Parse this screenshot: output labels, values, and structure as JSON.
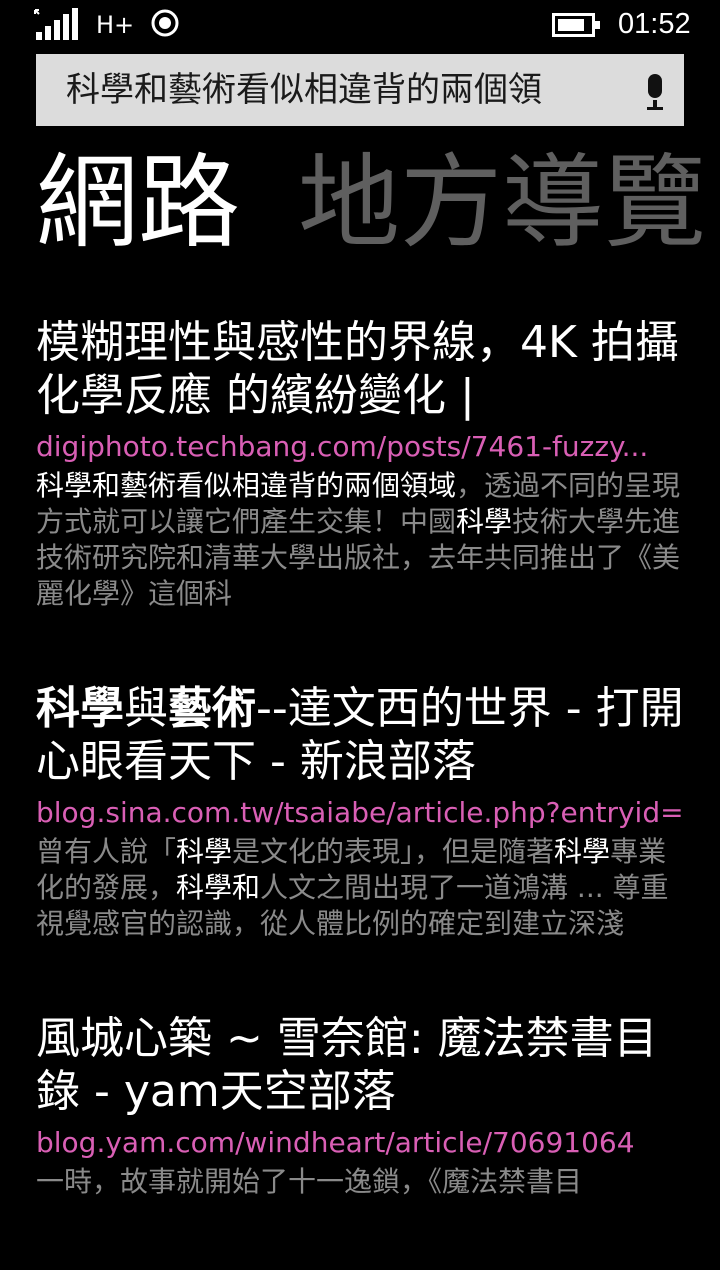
{
  "status_bar": {
    "network": "H+",
    "time": "01:52"
  },
  "search": {
    "query": "科學和藝術看似相違背的兩個領"
  },
  "pivots": [
    {
      "label": "網路"
    },
    {
      "label": "地方導覽"
    }
  ],
  "results": [
    {
      "title": "模糊理性與感性的界線，4K 拍攝 化學反應 的繽紛變化 |",
      "url": "digiphoto.techbang.com/posts/7461-fuzzy...",
      "snippet_segments": [
        {
          "text": "科學和藝術看似相違背的兩個領域",
          "hl": true
        },
        {
          "text": "，透過不同的呈現方式就可以讓它們產生交集！中國",
          "hl": false
        },
        {
          "text": "科學",
          "hl": true
        },
        {
          "text": "技術大學先進技術研究院和清華大學出版社，去年共同推出了《美麗化學》這個科",
          "hl": false
        }
      ]
    },
    {
      "title_segments": [
        {
          "text": "科學",
          "bold": true
        },
        {
          "text": "與",
          "bold": false
        },
        {
          "text": "藝術",
          "bold": true
        },
        {
          "text": "--達文西的世界 - 打開心眼看天下 - 新浪部落",
          "bold": false
        }
      ],
      "url": "blog.sina.com.tw/tsaiabe/article.php?entryid=...",
      "snippet_segments": [
        {
          "text": "曾有人說「",
          "hl": false
        },
        {
          "text": "科學",
          "hl": true
        },
        {
          "text": "是文化的表現」，但是隨著",
          "hl": false
        },
        {
          "text": "科學",
          "hl": true
        },
        {
          "text": "專業化的發展，",
          "hl": false
        },
        {
          "text": "科學和",
          "hl": true
        },
        {
          "text": "人文之間出現了一道鴻溝 ... 尊重視覺感官的認識，從人體比例的確定到建立深淺",
          "hl": false
        }
      ]
    },
    {
      "title": "風城心築 ~ 雪奈館: 魔法禁書目錄 - yam天空部落",
      "url": "blog.yam.com/windheart/article/70691064",
      "snippet_partial": "一時，故事就開始了十一逸鎖，《魔法禁書目"
    }
  ],
  "colors": {
    "background": "#000000",
    "url": "#d95fb5",
    "inactive_pivot": "#5f5f5f",
    "snippet": "#8a8a8a"
  }
}
